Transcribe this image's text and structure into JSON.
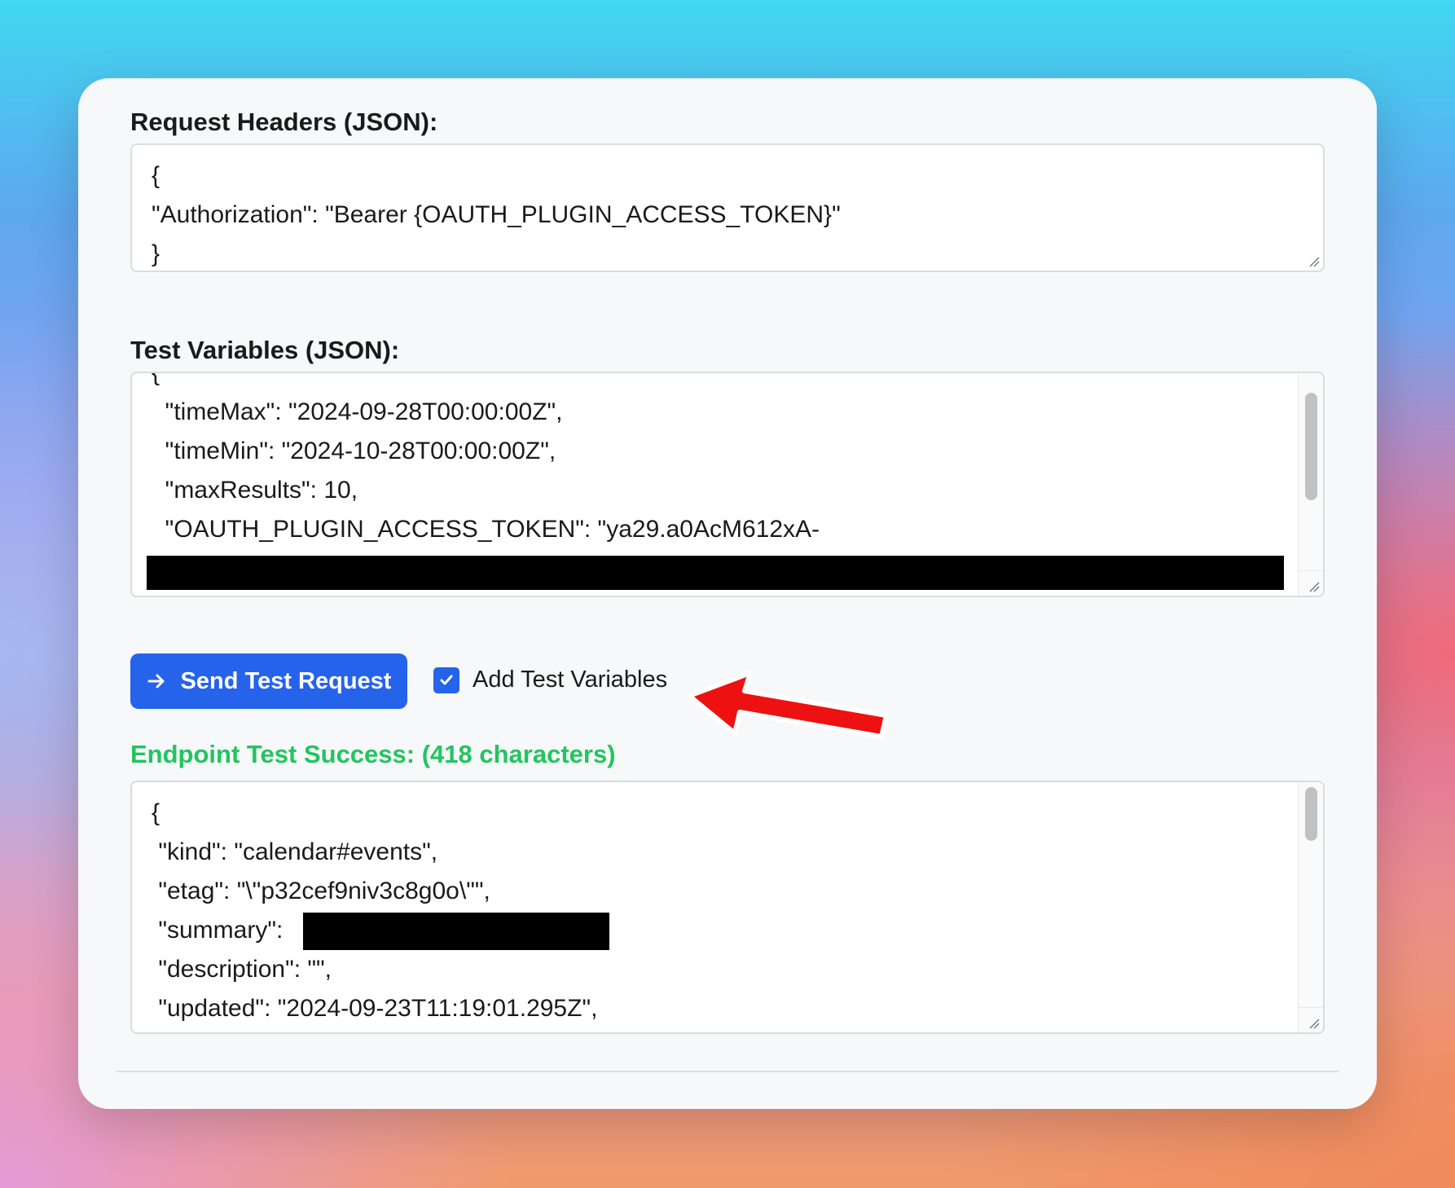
{
  "headers": {
    "label": "Request Headers (JSON):",
    "lines": [
      "{",
      "\"Authorization\": \"Bearer {OAUTH_PLUGIN_ACCESS_TOKEN}\"",
      "}"
    ]
  },
  "variables": {
    "label": "Test Variables (JSON):",
    "lines": [
      "{",
      "  \"timeMax\": \"2024-09-28T00:00:00Z\",",
      "  \"timeMin\": \"2024-10-28T00:00:00Z\",",
      "  \"maxResults\": 10,",
      "  \"OAUTH_PLUGIN_ACCESS_TOKEN\": \"ya29.a0AcM612xA-"
    ]
  },
  "actions": {
    "send_label": "Send Test Request",
    "checkbox_label": "Add Test Variables",
    "checkbox_checked": true
  },
  "result": {
    "status": "Endpoint Test Success: (418 characters)",
    "lines": [
      "{",
      " \"kind\": \"calendar#events\",",
      " \"etag\": \"\\\"p32cef9niv3c8g0o\\\"\",",
      " \"summary\":",
      " \"description\": \"\",",
      " \"updated\": \"2024-09-23T11:19:01.295Z\","
    ]
  },
  "colors": {
    "accent": "#2563eb",
    "success": "#22c55e",
    "annotation": "#ee1111"
  }
}
